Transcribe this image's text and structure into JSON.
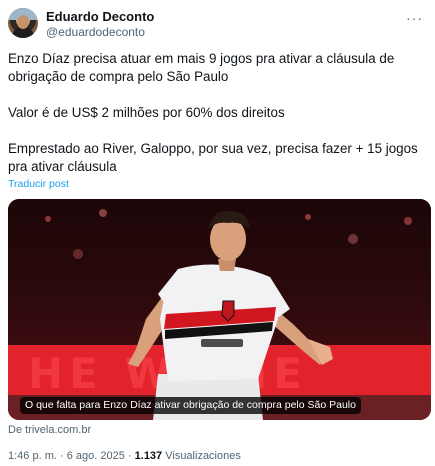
{
  "author": {
    "name": "Eduardo Deconto",
    "handle": "@eduardodeconto"
  },
  "more_icon": "ellipsis-icon",
  "post": {
    "paragraphs": [
      "Enzo Díaz precisa atuar em mais 9 jogos pra ativar a cláusula de obrigação de compra pelo São Paulo",
      "Valor é de US$ 2 milhões por 60% dos direitos",
      "Emprestado ao River, Galoppo, por sua vez, precisa fazer + 15 jogos pra ativar cláusula"
    ],
    "translate_label": "Traducir post"
  },
  "media": {
    "caption": "O que falta para Enzo Díaz ativar obrigação de compra pelo São Paulo"
  },
  "link_source": "De trivela.com.br",
  "meta": {
    "time": "1:46 p. m.",
    "separator1": "·",
    "date": "6 ago. 2025",
    "separator2": "·",
    "views_count": "1.137",
    "views_label": "Visualizaciones"
  },
  "colors": {
    "link_blue": "#1d9bf0",
    "secondary_text": "#536471",
    "primary_text": "#0f1419"
  }
}
